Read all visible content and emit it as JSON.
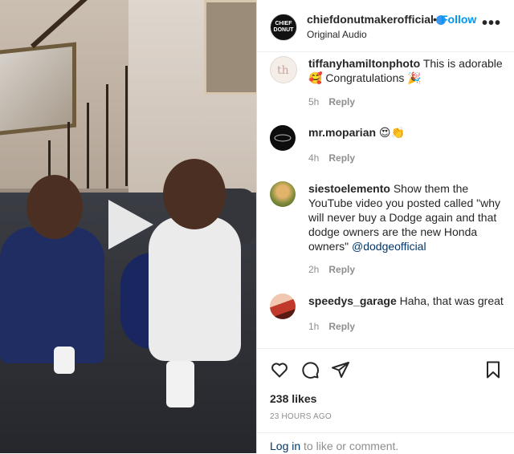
{
  "post": {
    "username": "chiefdonutmakerofficial",
    "follow_label": "Follow",
    "subtitle": "Original Audio",
    "avatar_text": "CHIEF DONUT",
    "more_label": "•••"
  },
  "comments": [
    {
      "username": "tiffanyhamiltonphoto",
      "text": "This is adorable 🥰 Congratulations 🎉",
      "time": "5h",
      "reply": "Reply"
    },
    {
      "username": "mr.moparian",
      "text": "😍👏",
      "time": "4h",
      "reply": "Reply"
    },
    {
      "username": "siestoelemento",
      "text": "Show them the YouTube video you posted called \"why will never buy a Dodge again and that dodge owners are the new Honda owners\"",
      "mention": "@dodgeofficial",
      "time": "2h",
      "reply": "Reply"
    },
    {
      "username": "speedys_garage",
      "text": "Haha, that was great",
      "time": "1h",
      "reply": "Reply"
    }
  ],
  "stats": {
    "likes": "238 likes",
    "posted": "23 HOURS AGO"
  },
  "login": {
    "link": "Log in",
    "text": " to like or comment."
  },
  "colors": {
    "accent": "#0095f6",
    "link": "#00376b",
    "muted": "#8e8e8e"
  }
}
